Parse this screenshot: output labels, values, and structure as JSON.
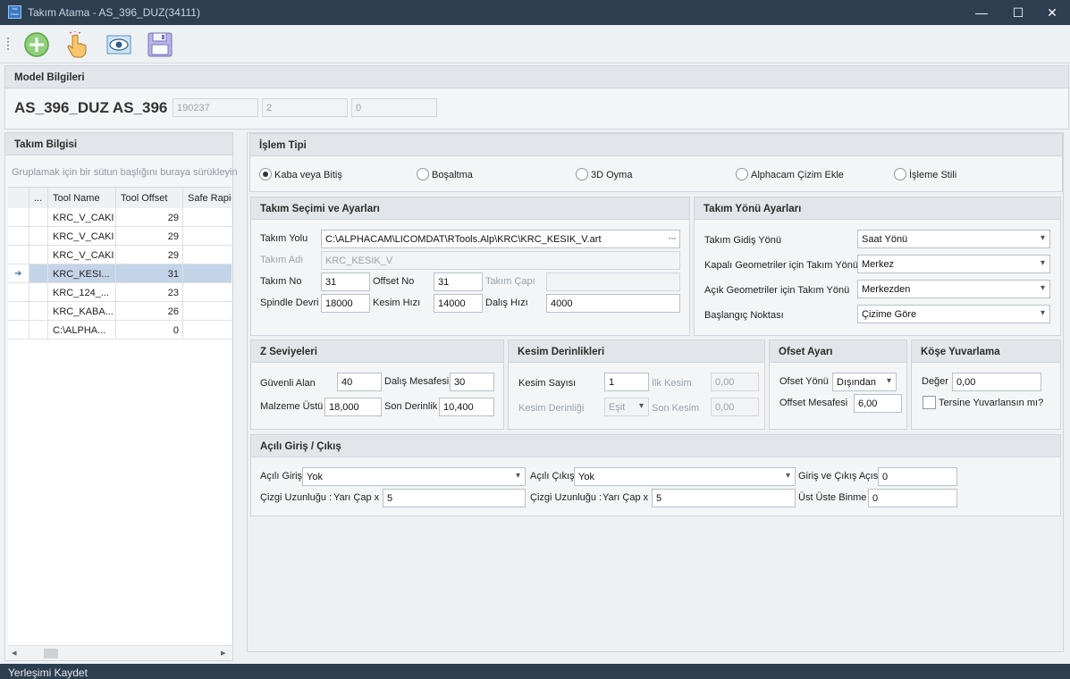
{
  "window": {
    "title": "Takım Atama - AS_396_DUZ(34111)",
    "app_icon_text": "Hal\nDoor",
    "minimize": "—",
    "maximize": "☐",
    "close": "✕"
  },
  "toolbar": {
    "add_icon": "plus-circle-icon",
    "pick_icon": "hand-pointer-icon",
    "view_icon": "eye-icon",
    "save_icon": "floppy-disk-icon"
  },
  "model": {
    "header": "Model Bilgileri",
    "name": "AS_396_DUZ AS_396",
    "field1": "190237",
    "field2": "2",
    "field3": "0"
  },
  "tool_info": {
    "header": "Takım Bilgisi",
    "group_hint": "Gruplamak için bir sütun başlığını buraya sürükleyin",
    "columns": [
      "...",
      "Tool Name",
      "Tool Offset",
      "Safe Rapid"
    ],
    "rows": [
      {
        "name": "KRC_V_CAKI",
        "offset": "29",
        "current": ""
      },
      {
        "name": "KRC_V_CAKI",
        "offset": "29",
        "current": ""
      },
      {
        "name": "KRC_V_CAKI",
        "offset": "29",
        "current": ""
      },
      {
        "name": "KRC_KESI...",
        "offset": "31",
        "current": "➔"
      },
      {
        "name": "KRC_124_...",
        "offset": "23",
        "current": ""
      },
      {
        "name": "KRC_KABA...",
        "offset": "26",
        "current": ""
      },
      {
        "name": "C:\\ALPHA...",
        "offset": "0",
        "current": ""
      }
    ],
    "scroll_left": "◂",
    "scroll_right": "▸"
  },
  "operation_type": {
    "header": "İşlem Tipi",
    "options": [
      "Kaba veya Bitiş",
      "Boşaltma",
      "3D Oyma",
      "Alphacam Çizim Ekle",
      "İşleme Stili"
    ],
    "selected_index": 0
  },
  "tool_selection": {
    "header": "Takım Seçimi ve Ayarları",
    "tool_path_label": "Takım Yolu",
    "tool_path_value": "C:\\ALPHACAM\\LICOMDAT\\RTools.Alp\\KRC\\KRC_KESIK_V.art",
    "browse": "···",
    "tool_name_label": "Takım Adı",
    "tool_name_value": "KRC_KESIK_V",
    "tool_no_label": "Takım No",
    "tool_no_value": "31",
    "offset_no_label": "Offset No",
    "offset_no_value": "31",
    "tool_dia_label": "Takım Çapı",
    "tool_dia_value": "",
    "spindle_label": "Spindle Devri",
    "spindle_value": "18000",
    "cut_speed_label": "Kesim Hızı",
    "cut_speed_value": "14000",
    "plunge_speed_label": "Dalış Hızı",
    "plunge_speed_value": "4000"
  },
  "tool_direction": {
    "header": "Takım Yönü Ayarları",
    "travel_dir_label": "Takım Gidiş Yönü",
    "travel_dir_value": "Saat Yönü",
    "closed_geo_label": "Kapalı Geometriler için Takım Yönü",
    "closed_geo_value": "Merkez",
    "open_geo_label": "Açık Geometriler için Takım Yönü",
    "open_geo_value": "Merkezden",
    "start_point_label": "Başlangıç Noktası",
    "start_point_value": "Çizime Göre"
  },
  "z_levels": {
    "header": "Z Seviyeleri",
    "safe_area_label": "Güvenli Alan",
    "safe_area_value": "40",
    "plunge_dist_label": "Dalış Mesafesi",
    "plunge_dist_value": "30",
    "material_top_label": "Malzeme Üstü",
    "material_top_value": "18,000",
    "final_depth_label": "Son Derinlik",
    "final_depth_value": "10,400"
  },
  "cut_depths": {
    "header": "Kesim Derinlikleri",
    "cut_count_label": "Kesim Sayısı",
    "cut_count_value": "1",
    "first_cut_label": "İlk Kesim",
    "first_cut_value": "0,00",
    "cut_depth_label": "Kesim Derinliği",
    "cut_depth_value": "Eşit",
    "last_cut_label": "Son Kesim",
    "last_cut_value": "0,00"
  },
  "offset": {
    "header": "Ofset Ayarı",
    "dir_label": "Ofset Yönü",
    "dir_value": "Dışından",
    "dist_label": "Offset Mesafesi",
    "dist_value": "6,00"
  },
  "corner": {
    "header": "Köşe Yuvarlama",
    "value_label": "Değer",
    "value": "0,00",
    "reverse_label": "Tersine Yuvarlansın mı?"
  },
  "lead": {
    "header": "Açılı Giriş / Çıkış",
    "in_label": "Açılı Giriş",
    "in_value": "Yok",
    "out_label": "Açılı Çıkış",
    "out_value": "Yok",
    "angle_label": "Giriş ve Çıkış Açısı",
    "angle_value": "0",
    "line_len_label1": "Çizgi Uzunluğu :",
    "radius_label1": "Yarı Çap x",
    "radius_value1": "5",
    "line_len_label2": "Çizgi Uzunluğu :",
    "radius_label2": "Yarı Çap x",
    "radius_value2": "5",
    "overlap_label": "Üst Üste Binme",
    "overlap_value": "0"
  },
  "status": {
    "text": "Yerleşimi Kaydet"
  }
}
